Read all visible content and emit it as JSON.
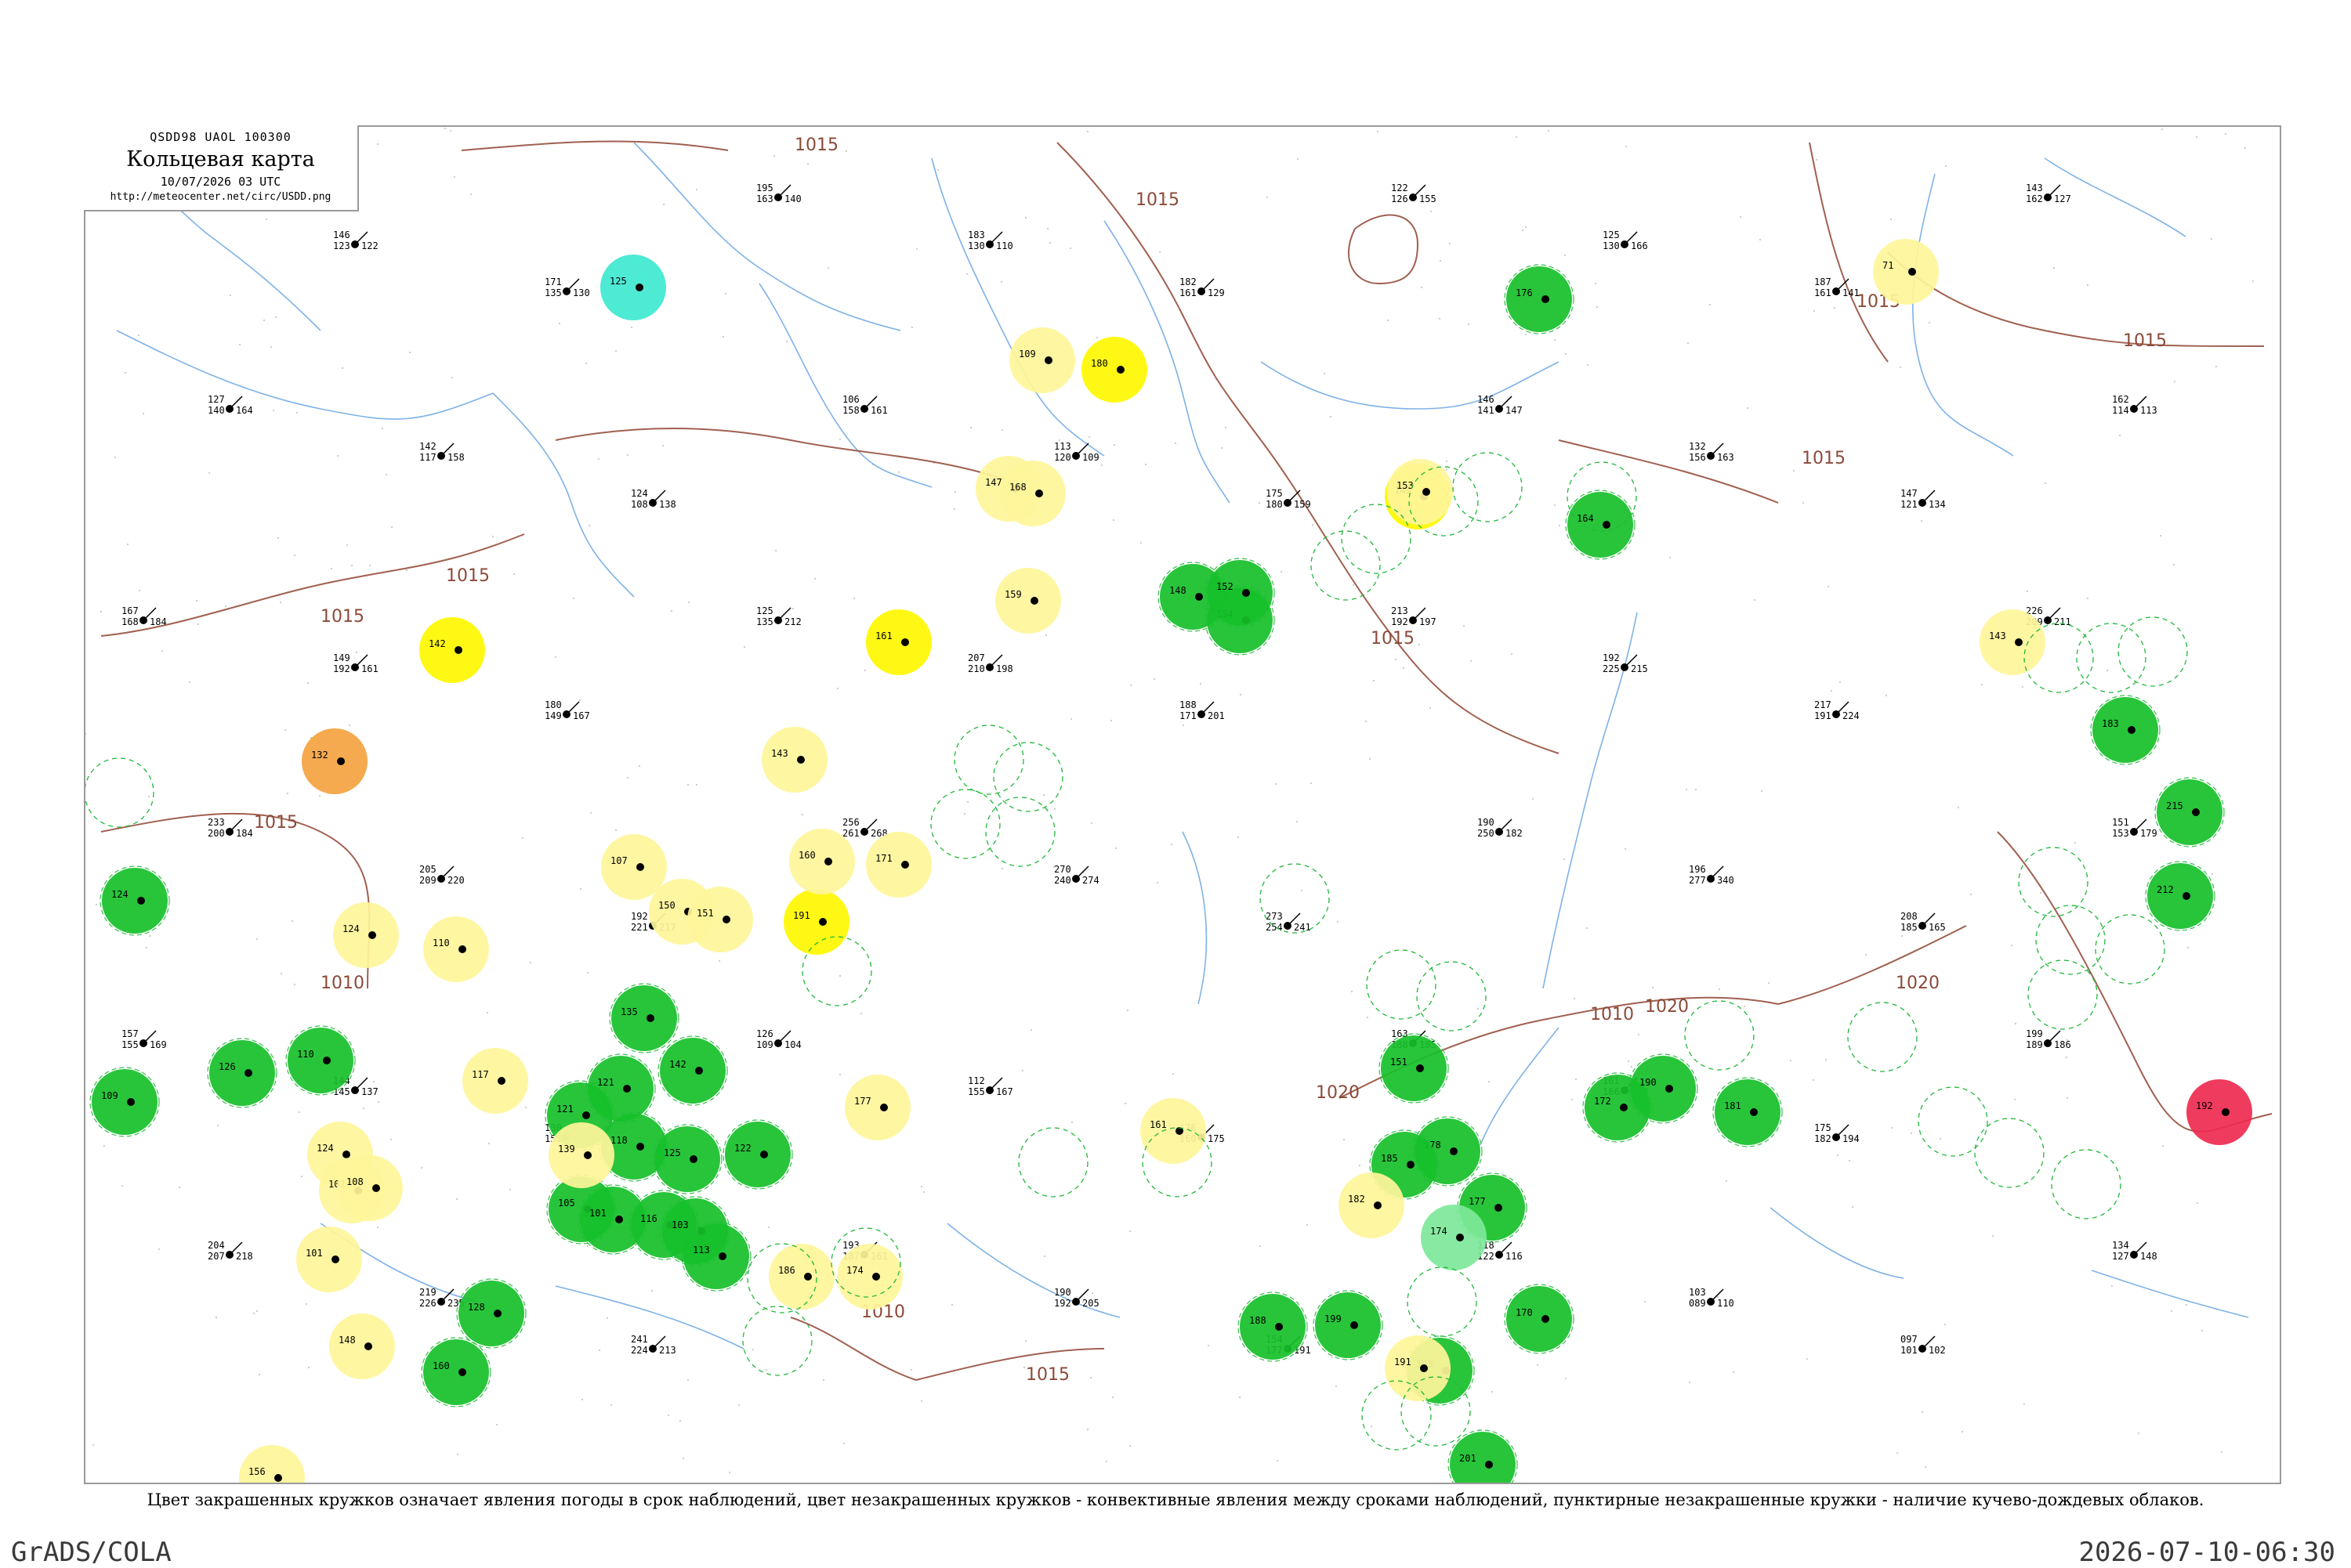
{
  "header": {
    "code": "QSDD98  UAOL  100300",
    "title": "Кольцевая карта",
    "datetime": "10/07/2026 03 UTC",
    "url": "http://meteocenter.net/circ/USDD.png"
  },
  "caption": "Цвет закрашенных кружков означает явления погоды в срок наблюдений, цвет незакрашенных кружков - конвективные явления между сроками наблюдений, пунктирные незакрашенные кружки - наличие кучево-дождевых облаков.",
  "footer": {
    "left": "GrADS/COLA",
    "right": "2026-07-10-06:30"
  },
  "colors": {
    "green": "#16c02a",
    "yellow": "#fff700",
    "pale_yellow": "#fff59a",
    "orange": "#f4a340",
    "red": "#ee2a50",
    "cyan": "#3ee8d0",
    "pale_green": "#7ee89a",
    "river": "#7fb2e6",
    "isobar": "#a06050",
    "dashed_ring": "#22b83a"
  },
  "isobars": [
    {
      "label": "1015"
    },
    {
      "label": "1015"
    },
    {
      "label": "1015"
    },
    {
      "label": "1015"
    },
    {
      "label": "1015"
    },
    {
      "label": "1015"
    },
    {
      "label": "1015"
    },
    {
      "label": "1015"
    },
    {
      "label": "1020"
    },
    {
      "label": "1020"
    },
    {
      "label": "1020"
    },
    {
      "label": "1010"
    },
    {
      "label": "1010"
    },
    {
      "label": "1010"
    },
    {
      "label": "1015"
    },
    {
      "label": "1015"
    }
  ],
  "stations": [
    {
      "t": "128",
      "d": "121",
      "p": "112"
    },
    {
      "t": "146",
      "d": "123",
      "p": "122"
    },
    {
      "t": "171",
      "d": "135",
      "p": "130"
    },
    {
      "t": "195",
      "d": "163",
      "p": "140"
    },
    {
      "t": "183",
      "d": "130",
      "p": "110"
    },
    {
      "t": "182",
      "d": "161",
      "p": "129"
    },
    {
      "t": "122",
      "d": "126",
      "p": "155"
    },
    {
      "t": "125",
      "d": "130",
      "p": "166"
    },
    {
      "t": "187",
      "d": "161",
      "p": "141"
    },
    {
      "t": "143",
      "d": "162",
      "p": "127"
    },
    {
      "t": "127",
      "d": "140",
      "p": "164"
    },
    {
      "t": "142",
      "d": "117",
      "p": "158"
    },
    {
      "t": "124",
      "d": "108",
      "p": "138"
    },
    {
      "t": "106",
      "d": "158",
      "p": "161"
    },
    {
      "t": "113",
      "d": "120",
      "p": "109"
    },
    {
      "t": "175",
      "d": "180",
      "p": "159"
    },
    {
      "t": "146",
      "d": "141",
      "p": "147"
    },
    {
      "t": "132",
      "d": "156",
      "p": "163"
    },
    {
      "t": "147",
      "d": "121",
      "p": "134"
    },
    {
      "t": "162",
      "d": "114",
      "p": "113"
    },
    {
      "t": "167",
      "d": "168",
      "p": "184"
    },
    {
      "t": "149",
      "d": "192",
      "p": "161"
    },
    {
      "t": "180",
      "d": "149",
      "p": "167"
    },
    {
      "t": "125",
      "d": "135",
      "p": "212"
    },
    {
      "t": "207",
      "d": "210",
      "p": "198"
    },
    {
      "t": "188",
      "d": "171",
      "p": "201"
    },
    {
      "t": "213",
      "d": "192",
      "p": "197"
    },
    {
      "t": "192",
      "d": "225",
      "p": "215"
    },
    {
      "t": "217",
      "d": "191",
      "p": "224"
    },
    {
      "t": "226",
      "d": "209",
      "p": "211"
    },
    {
      "t": "233",
      "d": "200",
      "p": "184"
    },
    {
      "t": "205",
      "d": "209",
      "p": "220"
    },
    {
      "t": "192",
      "d": "221",
      "p": "217"
    },
    {
      "t": "256",
      "d": "261",
      "p": "268"
    },
    {
      "t": "270",
      "d": "240",
      "p": "274"
    },
    {
      "t": "273",
      "d": "254",
      "p": "241"
    },
    {
      "t": "190",
      "d": "250",
      "p": "182"
    },
    {
      "t": "196",
      "d": "277",
      "p": "340"
    },
    {
      "t": "208",
      "d": "185",
      "p": "165"
    },
    {
      "t": "151",
      "d": "153",
      "p": "179"
    },
    {
      "t": "157",
      "d": "155",
      "p": "169"
    },
    {
      "t": "144",
      "d": "145",
      "p": "137"
    },
    {
      "t": "130",
      "d": "152",
      "p": "146"
    },
    {
      "t": "126",
      "d": "109",
      "p": "104"
    },
    {
      "t": "112",
      "d": "155",
      "p": "167"
    },
    {
      "t": "176",
      "d": "160",
      "p": "175"
    },
    {
      "t": "163",
      "d": "188",
      "p": "185"
    },
    {
      "t": "161",
      "d": "166",
      "p": "183"
    },
    {
      "t": "175",
      "d": "182",
      "p": "194"
    },
    {
      "t": "199",
      "d": "189",
      "p": "186"
    },
    {
      "t": "204",
      "d": "207",
      "p": "218"
    },
    {
      "t": "219",
      "d": "226",
      "p": "235"
    },
    {
      "t": "241",
      "d": "224",
      "p": "213"
    },
    {
      "t": "193",
      "d": "187",
      "p": "161"
    },
    {
      "t": "190",
      "d": "192",
      "p": "205"
    },
    {
      "t": "154",
      "d": "177",
      "p": "191"
    },
    {
      "t": "118",
      "d": "122",
      "p": "116"
    },
    {
      "t": "103",
      "d": "089",
      "p": "110"
    },
    {
      "t": "097",
      "d": "101",
      "p": "102"
    },
    {
      "t": "134",
      "d": "127",
      "p": "148"
    }
  ],
  "filled_circles": [
    {
      "color": "green",
      "label": "124"
    },
    {
      "color": "green",
      "label": "126"
    },
    {
      "color": "green",
      "label": "109"
    },
    {
      "color": "green",
      "label": "110"
    },
    {
      "color": "green",
      "label": "135"
    },
    {
      "color": "green",
      "label": "142"
    },
    {
      "color": "green",
      "label": "121"
    },
    {
      "color": "green",
      "label": "105"
    },
    {
      "color": "green",
      "label": "121"
    },
    {
      "color": "green",
      "label": "118"
    },
    {
      "color": "green",
      "label": "101"
    },
    {
      "color": "green",
      "label": "125"
    },
    {
      "color": "green",
      "label": "116"
    },
    {
      "color": "green",
      "label": "103"
    },
    {
      "color": "green",
      "label": "122"
    },
    {
      "color": "green",
      "label": "113"
    },
    {
      "color": "green",
      "label": "128"
    },
    {
      "color": "green",
      "label": "160"
    },
    {
      "color": "green",
      "label": "148"
    },
    {
      "color": "green",
      "label": "154"
    },
    {
      "color": "green",
      "label": "152"
    },
    {
      "color": "green",
      "label": "176"
    },
    {
      "color": "green",
      "label": "164"
    },
    {
      "color": "green",
      "label": "181"
    },
    {
      "color": "green",
      "label": "151"
    },
    {
      "color": "green",
      "label": "178"
    },
    {
      "color": "green",
      "label": "172"
    },
    {
      "color": "green",
      "label": "190"
    },
    {
      "color": "green",
      "label": "177"
    },
    {
      "color": "green",
      "label": "170"
    },
    {
      "color": "green",
      "label": "199"
    },
    {
      "color": "green",
      "label": "193"
    },
    {
      "color": "green",
      "label": "201"
    },
    {
      "color": "green",
      "label": "183"
    },
    {
      "color": "green",
      "label": "215"
    },
    {
      "color": "green",
      "label": "212"
    },
    {
      "color": "green",
      "label": "185"
    },
    {
      "color": "green",
      "label": "188"
    },
    {
      "color": "yellow",
      "label": "180"
    },
    {
      "color": "yellow",
      "label": "161"
    },
    {
      "color": "yellow",
      "label": "143"
    },
    {
      "color": "yellow",
      "label": "191"
    },
    {
      "color": "yellow",
      "label": "142"
    },
    {
      "color": "pale_yellow",
      "label": "109"
    },
    {
      "color": "pale_yellow",
      "label": "147"
    },
    {
      "color": "pale_yellow",
      "label": "168"
    },
    {
      "color": "pale_yellow",
      "label": "159"
    },
    {
      "color": "pale_yellow",
      "label": "143"
    },
    {
      "color": "pale_yellow",
      "label": "160"
    },
    {
      "color": "pale_yellow",
      "label": "171"
    },
    {
      "color": "pale_yellow",
      "label": "107"
    },
    {
      "color": "pale_yellow",
      "label": "150"
    },
    {
      "color": "pale_yellow",
      "label": "151"
    },
    {
      "color": "pale_yellow",
      "label": "124"
    },
    {
      "color": "pale_yellow",
      "label": "110"
    },
    {
      "color": "pale_yellow",
      "label": "117"
    },
    {
      "color": "pale_yellow",
      "label": "124"
    },
    {
      "color": "pale_yellow",
      "label": "102"
    },
    {
      "color": "pale_yellow",
      "label": "108"
    },
    {
      "color": "pale_yellow",
      "label": "101"
    },
    {
      "color": "pale_yellow",
      "label": "148"
    },
    {
      "color": "pale_yellow",
      "label": "156"
    },
    {
      "color": "pale_yellow",
      "label": "139"
    },
    {
      "color": "pale_yellow",
      "label": "186"
    },
    {
      "color": "pale_yellow",
      "label": "174"
    },
    {
      "color": "pale_yellow",
      "label": "177"
    },
    {
      "color": "pale_yellow",
      "label": "161"
    },
    {
      "color": "pale_yellow",
      "label": "182"
    },
    {
      "color": "pale_yellow",
      "label": "153"
    },
    {
      "color": "pale_yellow",
      "label": "71"
    },
    {
      "color": "pale_yellow",
      "label": "143"
    },
    {
      "color": "pale_yellow",
      "label": "191"
    },
    {
      "color": "orange",
      "label": "132"
    },
    {
      "color": "red",
      "label": "192"
    },
    {
      "color": "cyan",
      "label": "125"
    },
    {
      "color": "pale_green",
      "label": "174"
    }
  ]
}
